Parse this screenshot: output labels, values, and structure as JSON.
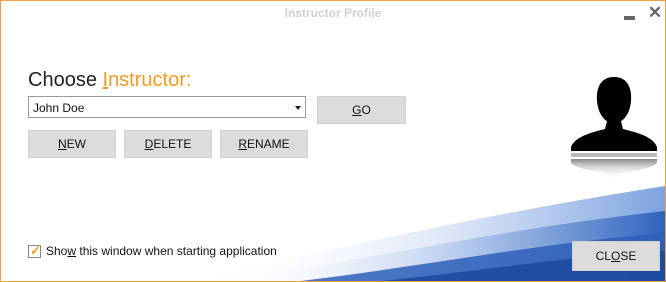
{
  "window": {
    "title": "Instructor Profile",
    "minimize_icon": "minimize-icon",
    "close_icon": "close-icon"
  },
  "heading": {
    "prefix": "Choose ",
    "accent_first": "I",
    "accent_rest": "nstructor:"
  },
  "instructor_select": {
    "value": "John Doe"
  },
  "buttons": {
    "go": {
      "u": "G",
      "rest": "O"
    },
    "new": {
      "u": "N",
      "rest": "EW"
    },
    "delete": {
      "u": "D",
      "rest": "ELETE"
    },
    "rename": {
      "u": "R",
      "rest": "ENAME"
    },
    "close": {
      "pre": "CL",
      "u": "O",
      "post": "SE"
    }
  },
  "startup_checkbox": {
    "checked": true,
    "label_pre": "Sho",
    "label_u": "w",
    "label_post": " this window when starting application"
  },
  "colors": {
    "accent": "#f59a23",
    "border": "#f0a040",
    "button_bg": "#dcdcdc",
    "swoosh_blue": "#3a6fc4"
  }
}
